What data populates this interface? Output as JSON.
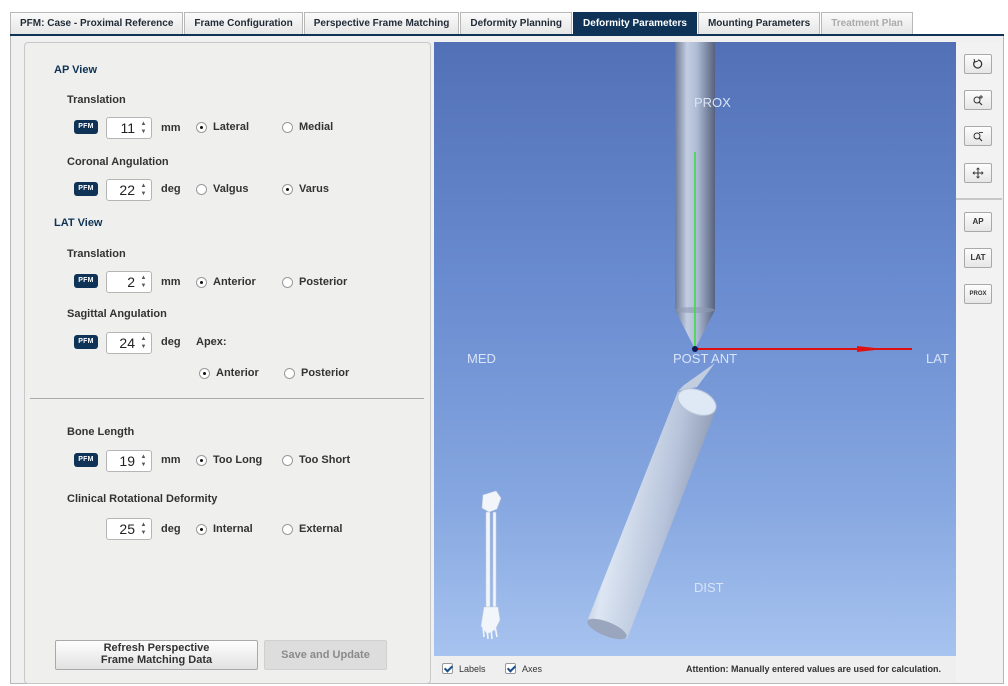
{
  "tabs": [
    {
      "label": "PFM: Case - Proximal Reference",
      "state": "normal"
    },
    {
      "label": "Frame Configuration",
      "state": "normal"
    },
    {
      "label": "Perspective Frame Matching",
      "state": "normal"
    },
    {
      "label": "Deformity Planning",
      "state": "normal"
    },
    {
      "label": "Deformity Parameters",
      "state": "active"
    },
    {
      "label": "Mounting Parameters",
      "state": "normal"
    },
    {
      "label": "Treatment Plan",
      "state": "disabled"
    }
  ],
  "badge": "PFM",
  "ap_view": {
    "title": "AP View",
    "translation": {
      "label": "Translation",
      "value": "11",
      "unit": "mm",
      "option_a": "Lateral",
      "option_b": "Medial",
      "selected": "a"
    },
    "coronal": {
      "label": "Coronal Angulation",
      "value": "22",
      "unit": "deg",
      "option_a": "Valgus",
      "option_b": "Varus",
      "selected": "b"
    }
  },
  "lat_view": {
    "title": "LAT View",
    "translation": {
      "label": "Translation",
      "value": "2",
      "unit": "mm",
      "option_a": "Anterior",
      "option_b": "Posterior",
      "selected": "a"
    },
    "sagittal": {
      "label": "Sagittal Angulation",
      "value": "24",
      "unit": "deg",
      "apex_label": "Apex:",
      "option_a": "Anterior",
      "option_b": "Posterior",
      "selected": "a"
    }
  },
  "bone_length": {
    "label": "Bone Length",
    "value": "19",
    "unit": "mm",
    "option_a": "Too Long",
    "option_b": "Too Short",
    "selected": "a"
  },
  "rotation": {
    "label": "Clinical Rotational Deformity",
    "value": "25",
    "unit": "deg",
    "option_a": "Internal",
    "option_b": "External",
    "selected": "a"
  },
  "buttons": {
    "refresh": "Refresh Perspective Frame Matching Data",
    "save": "Save and Update"
  },
  "view3d": {
    "labels": {
      "prox": "PROX",
      "med": "MED",
      "post_ant": "POST ANT",
      "lat": "LAT",
      "dist": "DIST"
    },
    "checks": {
      "labels": "Labels",
      "axes": "Axes"
    },
    "attention": "Attention: Manually entered values are used for calculation."
  },
  "toolbar": {
    "ap": "AP",
    "lat": "LAT",
    "prox": "PROX"
  },
  "icons": [
    "reset-icon",
    "zoom-in-icon",
    "zoom-out-icon",
    "pan-icon"
  ],
  "colors": {
    "accent": "#0e3356",
    "axis_red": "#e01010",
    "axis_green": "#30d030"
  }
}
